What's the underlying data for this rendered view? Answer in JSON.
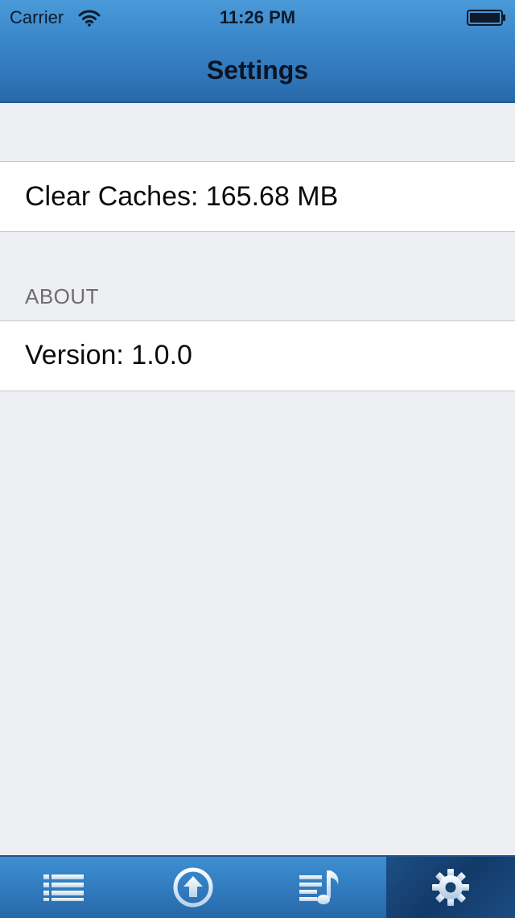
{
  "status_bar": {
    "carrier": "Carrier",
    "time": "11:26 PM",
    "wifi_icon": "wifi-icon",
    "battery_icon": "battery-icon"
  },
  "nav": {
    "title": "Settings"
  },
  "sections": [
    {
      "header": "",
      "rows": [
        {
          "label": "Clear Caches: 165.68 MB"
        }
      ]
    },
    {
      "header": "ABOUT",
      "rows": [
        {
          "label": "Version: 1.0.0"
        }
      ]
    }
  ],
  "tab_bar": {
    "tabs": [
      {
        "icon": "list-icon",
        "selected": false
      },
      {
        "icon": "upload-icon",
        "selected": false
      },
      {
        "icon": "playlist-icon",
        "selected": false
      },
      {
        "icon": "gear-icon",
        "selected": true
      }
    ]
  },
  "colors": {
    "bar_blue": "#3a86c9",
    "background": "#eeeff2",
    "cell_background": "#ffffff",
    "section_header_text": "#6d6d72",
    "selected_tab": "#163f70"
  }
}
